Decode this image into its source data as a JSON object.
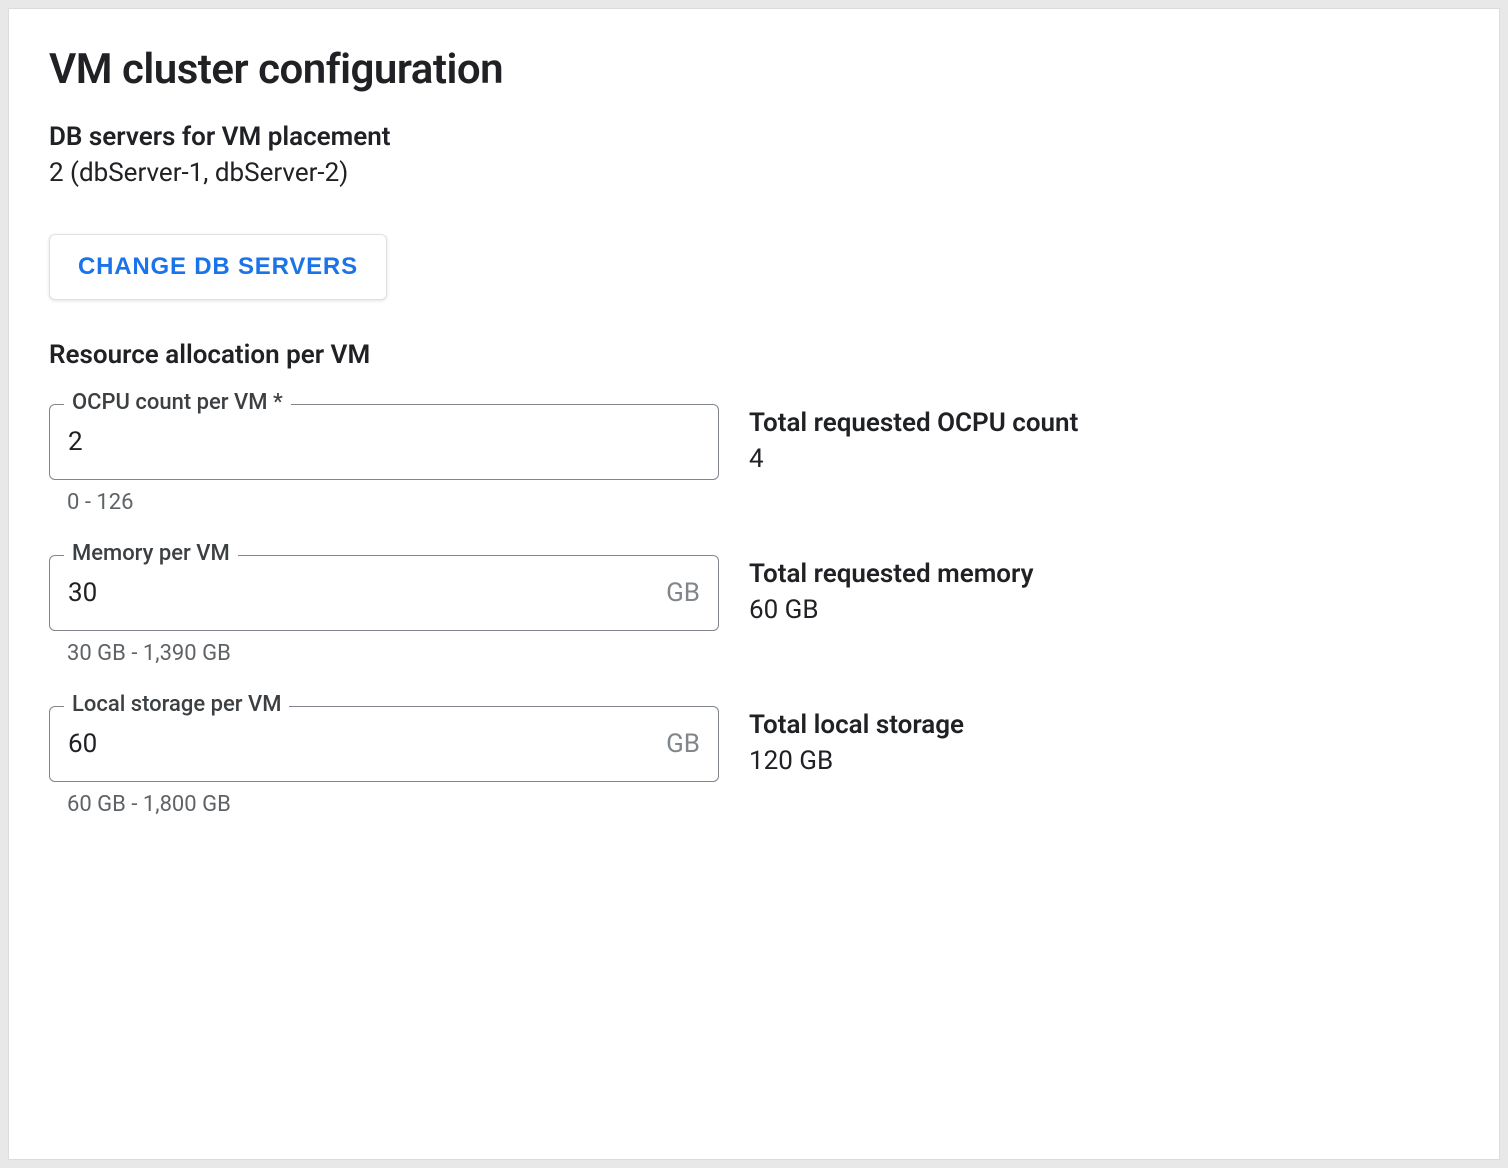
{
  "title": "VM cluster configuration",
  "dbServers": {
    "label": "DB servers for VM placement",
    "value": "2 (dbServer-1, dbServer-2)",
    "changeButton": "CHANGE DB SERVERS"
  },
  "resourceHeading": "Resource allocation per VM",
  "fields": {
    "ocpu": {
      "label": "OCPU count per VM *",
      "value": "2",
      "helper": "0 - 126",
      "totalLabel": "Total requested OCPU count",
      "totalValue": "4"
    },
    "memory": {
      "label": "Memory per VM",
      "value": "30",
      "suffix": "GB",
      "helper": "30 GB - 1,390 GB",
      "totalLabel": "Total requested memory",
      "totalValue": "60 GB"
    },
    "storage": {
      "label": "Local storage per VM",
      "value": "60",
      "suffix": "GB",
      "helper": "60 GB - 1,800 GB",
      "totalLabel": "Total local storage",
      "totalValue": "120 GB"
    }
  }
}
